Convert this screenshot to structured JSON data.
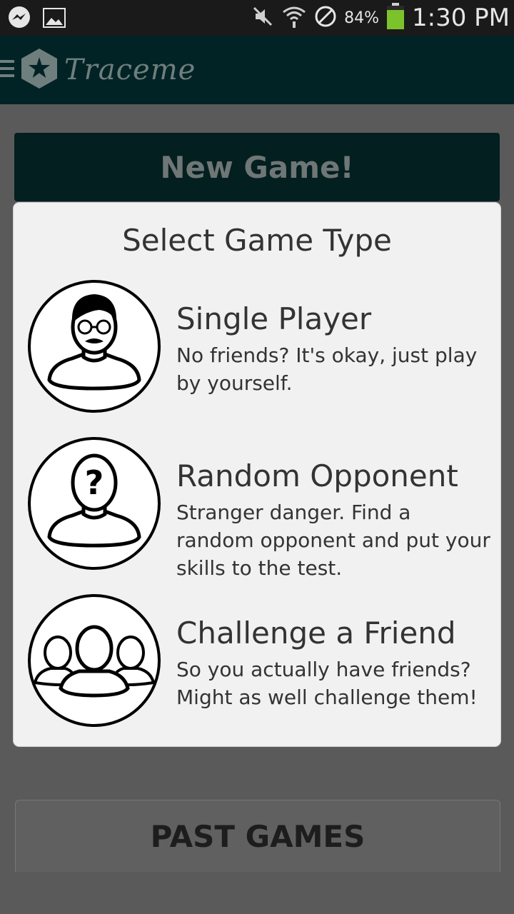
{
  "app": {
    "title": "Traceme"
  },
  "status_bar": {
    "battery_percent": "84%",
    "time": "1:30 PM"
  },
  "main": {
    "new_game_label": "New Game!",
    "past_games_label": "PAST GAMES"
  },
  "dialog": {
    "title": "Select Game Type",
    "options": [
      {
        "title": "Single Player",
        "description": "No friends? It's okay, just play by yourself.",
        "icon": "single-player-icon"
      },
      {
        "title": "Random Opponent",
        "description": "Stranger danger. Find a random opponent and put your skills to the test.",
        "icon": "random-opponent-icon"
      },
      {
        "title": "Challenge a Friend",
        "description": "So you actually have friends? Might as well challenge them!",
        "icon": "challenge-friend-icon"
      }
    ]
  },
  "colors": {
    "app_bar": "#022325",
    "dim_background": "#5a5a5a",
    "dialog_background": "#f2f1f2",
    "battery_green": "#7cc22a"
  }
}
